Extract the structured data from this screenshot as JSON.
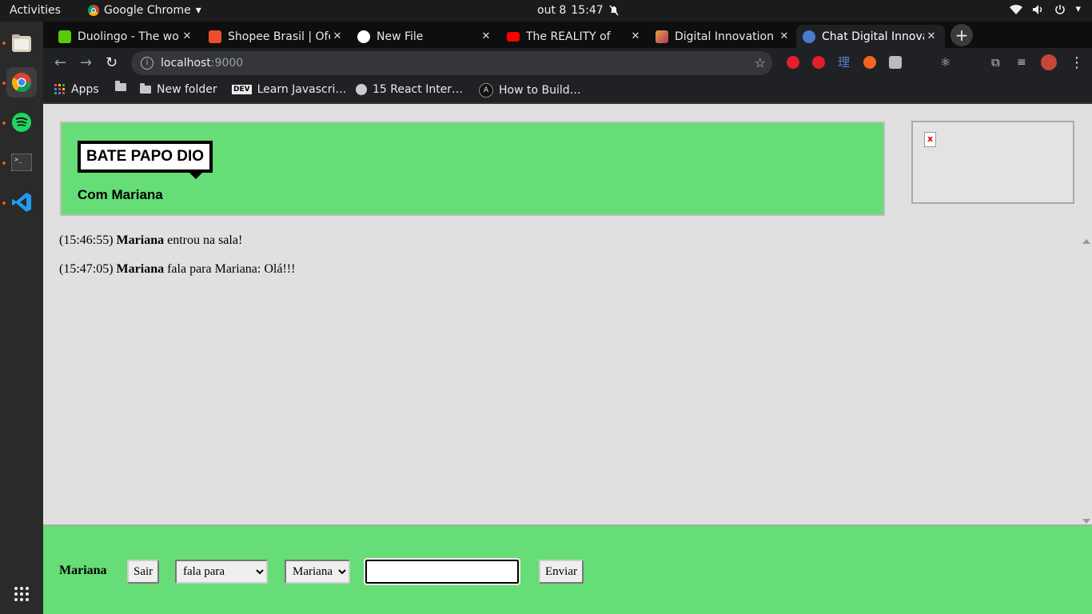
{
  "topbar": {
    "activities": "Activities",
    "app_name": "Google Chrome",
    "date": "out 8",
    "time": "15:47"
  },
  "dock": {
    "items": [
      "files",
      "chrome",
      "spotify",
      "terminal",
      "vscode"
    ],
    "show_apps": "show-applications"
  },
  "tabs": [
    {
      "title": "Duolingo - The world's best way to learn",
      "favicon_color": "#58cc02"
    },
    {
      "title": "Shopee Brasil | Ofertas",
      "favicon_color": "#ee4d2d"
    },
    {
      "title": "New File",
      "favicon_color": "#ffffff"
    },
    {
      "title": "The REALITY of",
      "favicon_color": "#ff0000"
    },
    {
      "title": "Digital Innovation One",
      "favicon_color": "#e8a33d"
    },
    {
      "title": "Chat Digital Innovation",
      "favicon_color": "#4a7bd1"
    }
  ],
  "toolbar": {
    "url_host": "localhost",
    "url_port": ":9000"
  },
  "bookmarks": {
    "apps": "Apps",
    "new_folder": "New folder",
    "learn_js": "Learn Javascri…",
    "react": "15 React Inter…",
    "how_to": "How to Build…"
  },
  "chat": {
    "logo": "BATE PAPO DIO",
    "with": "Com Mariana",
    "messages": [
      {
        "time": "(15:46:55)",
        "user": "Mariana",
        "text": " entrou na sala!"
      },
      {
        "time": "(15:47:05)",
        "user": "Mariana",
        "text": " fala para Mariana: Olá!!!"
      }
    ]
  },
  "footer": {
    "user": "Mariana",
    "exit_label": "Sair",
    "action_selected": "fala para",
    "target_selected": "Mariana",
    "message_value": "",
    "send_label": "Enviar"
  },
  "colors": {
    "accent_green": "#66dd77",
    "page_bg": "#e0e0e0"
  }
}
